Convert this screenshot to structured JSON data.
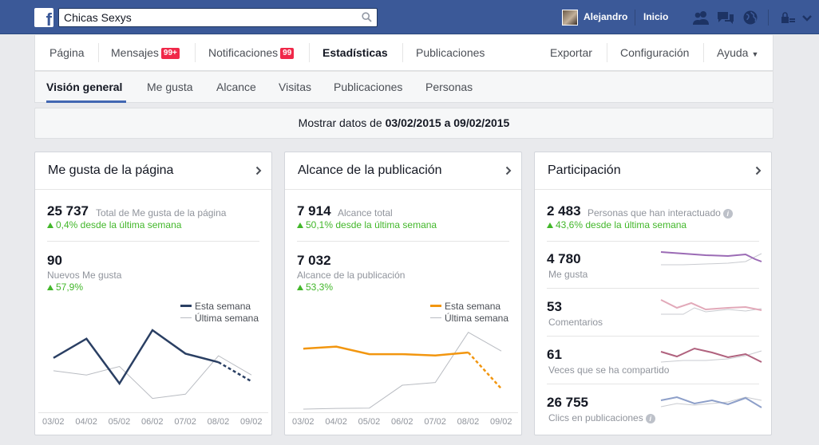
{
  "topbar": {
    "search_value": "Chicas Sexys",
    "user_name": "Alejandro",
    "home_label": "Inicio"
  },
  "page_nav": {
    "items": [
      {
        "label": "Página"
      },
      {
        "label": "Mensajes",
        "badge": "99+"
      },
      {
        "label": "Notificaciones",
        "badge": "99"
      },
      {
        "label": "Estadísticas"
      },
      {
        "label": "Publicaciones"
      }
    ],
    "right": [
      {
        "label": "Exportar"
      },
      {
        "label": "Configuración"
      },
      {
        "label": "Ayuda"
      }
    ]
  },
  "sub_nav": {
    "items": [
      "Visión general",
      "Me gusta",
      "Alcance",
      "Visitas",
      "Publicaciones",
      "Personas"
    ]
  },
  "date_range": {
    "prefix": "Mostrar datos de",
    "start": "03/02/2015",
    "connector": "a",
    "end": "09/02/2015"
  },
  "likes_card": {
    "title": "Me gusta de la página",
    "total_value": "25 737",
    "total_label": "Total de Me gusta de la página",
    "total_change": "0,4% desde la última semana",
    "new_value": "90",
    "new_label": "Nuevos Me gusta",
    "new_change": "57,9%",
    "legend_this": "Esta semana",
    "legend_last": "Última semana",
    "color_this": "#2a3f63"
  },
  "reach_card": {
    "title": "Alcance de la publicación",
    "total_value": "7 914",
    "total_label": "Alcance total",
    "total_change": "50,1% desde la última semana",
    "post_value": "7 032",
    "post_label": "Alcance de la publicación",
    "post_change": "53,3%",
    "legend_this": "Esta semana",
    "legend_last": "Última semana",
    "color_this": "#f2960f"
  },
  "engagement_card": {
    "title": "Participación",
    "total_value": "2 483",
    "total_label": "Personas que han interactuado",
    "total_change": "43,6% desde la última semana",
    "rows": [
      {
        "value": "4 780",
        "label": "Me gusta",
        "color": "#9b6bb5"
      },
      {
        "value": "53",
        "label": "Comentarios",
        "color": "#e2a9b9"
      },
      {
        "value": "61",
        "label": "Veces que se ha compartido",
        "color": "#b0627e"
      },
      {
        "value": "26 755",
        "label": "Clics en publicaciones",
        "color": "#8d9fc9"
      }
    ]
  },
  "chart_data": [
    {
      "type": "line",
      "x": [
        "03/02",
        "04/02",
        "05/02",
        "06/02",
        "07/02",
        "08/02",
        "09/02"
      ],
      "series": [
        {
          "name": "Esta semana",
          "values": [
            24,
            33,
            12,
            37,
            26,
            22,
            13
          ],
          "color": "#2a3f63",
          "last_dashed": true
        },
        {
          "name": "Última semana",
          "values": [
            18,
            16,
            20,
            5,
            7,
            25,
            16
          ],
          "color": "#b9bcc2"
        }
      ],
      "ylim": [
        0,
        40
      ]
    },
    {
      "type": "line",
      "x": [
        "03/02",
        "04/02",
        "05/02",
        "06/02",
        "07/02",
        "08/02",
        "09/02"
      ],
      "series": [
        {
          "name": "Esta semana",
          "values": [
            1770,
            1830,
            1610,
            1610,
            1570,
            1660,
            600
          ],
          "color": "#f2960f",
          "last_dashed": true
        },
        {
          "name": "Última semana",
          "values": [
            0,
            20,
            30,
            700,
            780,
            2250,
            1700
          ],
          "color": "#b9bcc2"
        }
      ],
      "ylim": [
        0,
        2500
      ]
    }
  ]
}
